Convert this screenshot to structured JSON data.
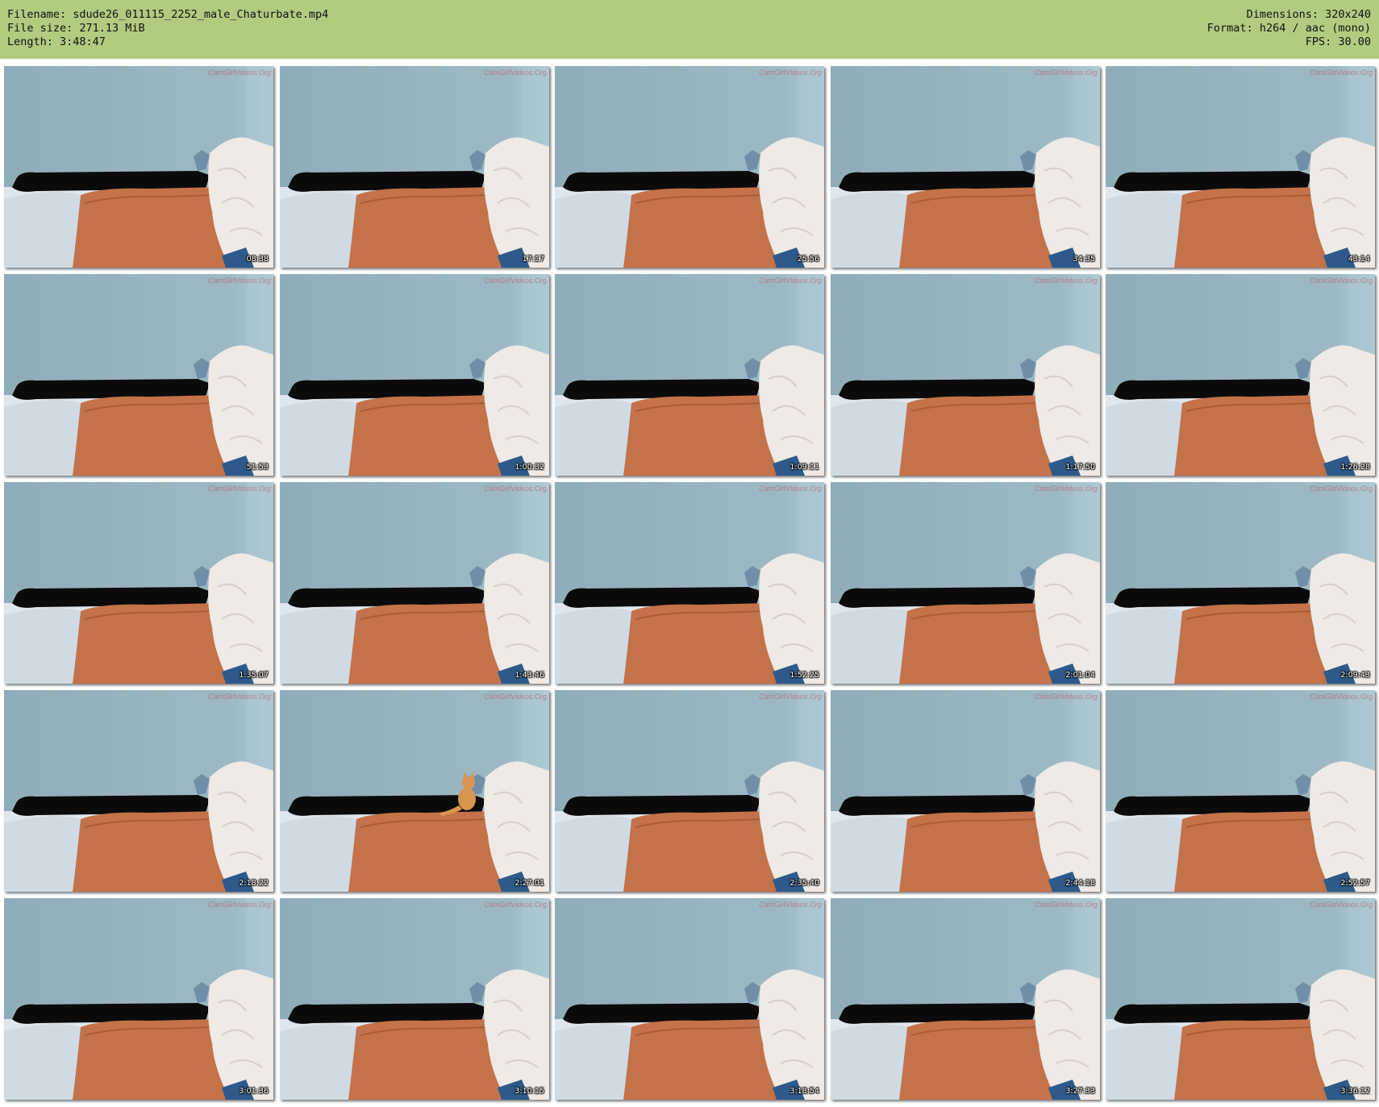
{
  "header": {
    "left": [
      "Filename: sdude26_011115_2252_male_Chaturbate.mp4",
      "File size: 271.13 MiB",
      "Length: 3:48:47"
    ],
    "right": [
      "Dimensions: 320x240",
      "Format: h264 / aac (mono)",
      "FPS: 30.00"
    ],
    "bg_color": "#b0cc80"
  },
  "watermark": "CamGirlVideos.Org",
  "thumbnails": [
    {
      "timestamp": "08:38"
    },
    {
      "timestamp": "17:17"
    },
    {
      "timestamp": "25:56"
    },
    {
      "timestamp": "34:35"
    },
    {
      "timestamp": "43:14"
    },
    {
      "timestamp": "51:53"
    },
    {
      "timestamp": "1:00:32"
    },
    {
      "timestamp": "1:09:11"
    },
    {
      "timestamp": "1:17:50"
    },
    {
      "timestamp": "1:26:28"
    },
    {
      "timestamp": "1:35:07"
    },
    {
      "timestamp": "1:43:46"
    },
    {
      "timestamp": "1:52:25"
    },
    {
      "timestamp": "2:01:04"
    },
    {
      "timestamp": "2:09:43"
    },
    {
      "timestamp": "2:18:22"
    },
    {
      "timestamp": "2:27:01",
      "cat": true
    },
    {
      "timestamp": "2:35:40"
    },
    {
      "timestamp": "2:44:18"
    },
    {
      "timestamp": "2:52:57"
    },
    {
      "timestamp": "3:01:36"
    },
    {
      "timestamp": "3:10:15"
    },
    {
      "timestamp": "3:18:54"
    },
    {
      "timestamp": "3:27:33"
    },
    {
      "timestamp": "3:36:12"
    }
  ]
}
